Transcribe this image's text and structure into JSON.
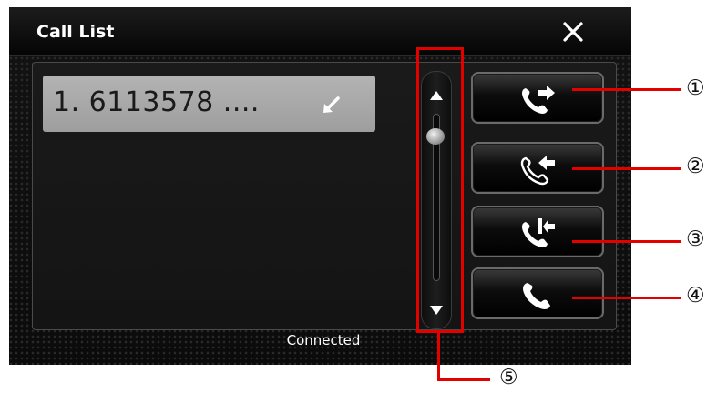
{
  "title": "Call List",
  "close_icon": "close-icon",
  "call_list": [
    {
      "label": "1. 6113578 ....",
      "icon": "missed-call-arrow-icon"
    }
  ],
  "actions": [
    {
      "icon": "outgoing-call-icon"
    },
    {
      "icon": "incoming-call-icon"
    },
    {
      "icon": "missed-call-icon"
    },
    {
      "icon": "phone-icon"
    }
  ],
  "status": "Connected",
  "callouts": [
    "①",
    "②",
    "③",
    "④",
    "⑤"
  ],
  "colors": {
    "annotation": "#e50000",
    "list_item": "#a8a8a8",
    "background": "#0e0e0e"
  }
}
